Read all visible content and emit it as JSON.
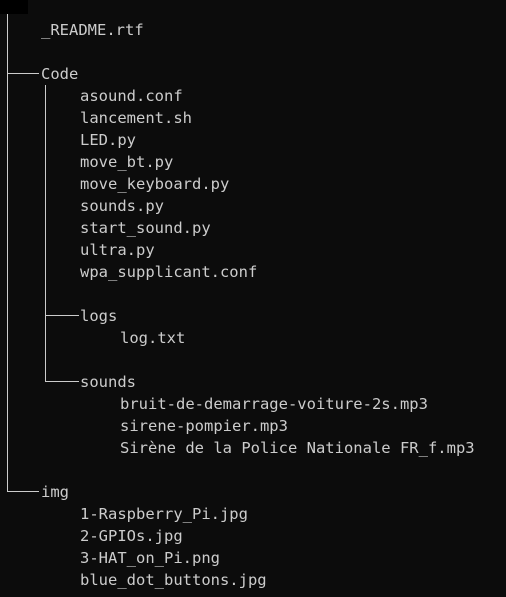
{
  "tree": {
    "root_files": {
      "readme": "_README.rtf"
    },
    "code": {
      "label": "Code",
      "files": [
        "asound.conf",
        "lancement.sh",
        "LED.py",
        "move_bt.py",
        "move_keyboard.py",
        "sounds.py",
        "start_sound.py",
        "ultra.py",
        "wpa_supplicant.conf"
      ],
      "logs": {
        "label": "logs",
        "files": [
          "log.txt"
        ]
      },
      "sounds": {
        "label": "sounds",
        "files": [
          "bruit-de-demarrage-voiture-2s.mp3",
          "sirene-pompier.mp3",
          "Sirène de la Police Nationale FR_f.mp3"
        ]
      }
    },
    "img": {
      "label": "img",
      "files": [
        "1-Raspberry_Pi.jpg",
        "2-GPIOs.jpg",
        "3-HAT_on_Pi.png",
        "blue_dot_buttons.jpg"
      ]
    }
  }
}
